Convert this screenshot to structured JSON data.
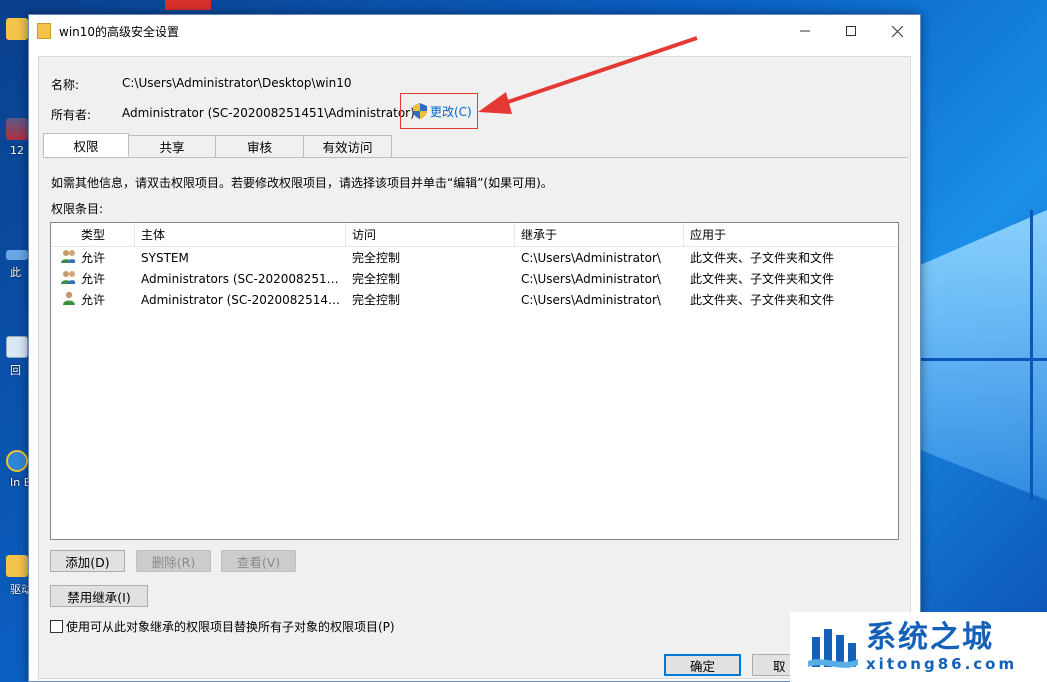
{
  "window": {
    "title": "win10的高级安全设置"
  },
  "name_row": {
    "label": "名称:",
    "value": "C:\\Users\\Administrator\\Desktop\\win10"
  },
  "owner_row": {
    "label": "所有者:",
    "value": "Administrator (SC-202008251451\\Administrator)",
    "change_label": "更改(C)"
  },
  "tabs": [
    {
      "label": "权限",
      "active": true
    },
    {
      "label": "共享",
      "active": false
    },
    {
      "label": "审核",
      "active": false
    },
    {
      "label": "有效访问",
      "active": false
    }
  ],
  "info_text": "如需其他信息，请双击权限项目。若要修改权限项目，请选择该项目并单击“编辑”(如果可用)。",
  "permissions_label": "权限条目:",
  "table": {
    "columns": [
      "类型",
      "主体",
      "访问",
      "继承于",
      "应用于"
    ],
    "rows": [
      {
        "icon": "user-group-icon",
        "type": "允许",
        "principal": "SYSTEM",
        "access": "完全控制",
        "inherited": "C:\\Users\\Administrator\\",
        "applies": "此文件夹、子文件夹和文件"
      },
      {
        "icon": "user-group-icon",
        "type": "允许",
        "principal": "Administrators (SC-20200825145...",
        "access": "完全控制",
        "inherited": "C:\\Users\\Administrator\\",
        "applies": "此文件夹、子文件夹和文件"
      },
      {
        "icon": "user-icon",
        "type": "允许",
        "principal": "Administrator (SC-20200825145...",
        "access": "完全控制",
        "inherited": "C:\\Users\\Administrator\\",
        "applies": "此文件夹、子文件夹和文件"
      }
    ]
  },
  "buttons": {
    "add": "添加(D)",
    "remove": "删除(R)",
    "view": "查看(V)",
    "disable_inheritance": "禁用继承(I)",
    "ok": "确定",
    "cancel": "取"
  },
  "checkbox_label": "使用可从此对象继承的权限项目替换所有子对象的权限项目(P)",
  "desktop_icons": [
    "12",
    "此",
    "回",
    "In Ex",
    "驱动"
  ],
  "watermark": {
    "cn": "系统之城",
    "en": "xitong86.com"
  },
  "colors": {
    "accent": "#0078d7",
    "annotation": "#e53935",
    "watermark": "#1560b8"
  }
}
